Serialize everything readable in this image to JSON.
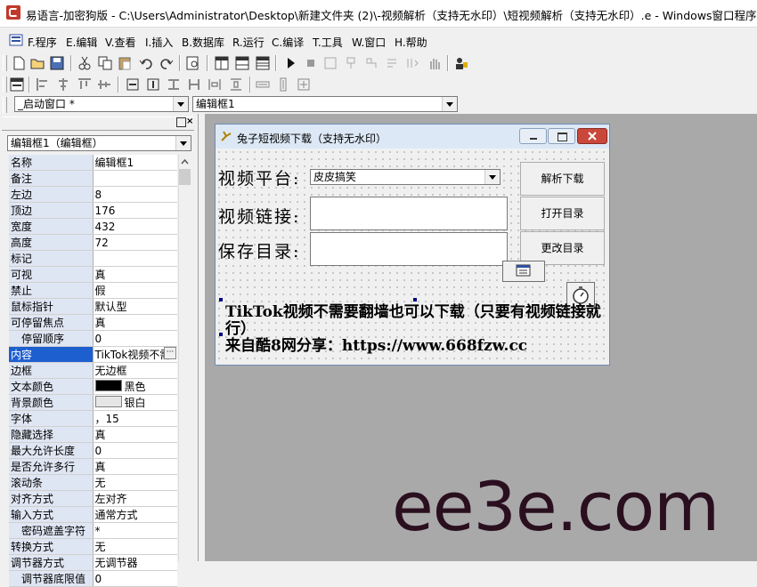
{
  "window": {
    "title": "易语言-加密狗版 - C:\\Users\\Administrator\\Desktop\\新建文件夹 (2)\\-视频解析（支持无水印）\\短视频解析（支持无水印）.e - Windows窗口程序 - [窗口"
  },
  "menu": [
    {
      "label": "F.程序"
    },
    {
      "label": "E.编辑"
    },
    {
      "label": "V.查看"
    },
    {
      "label": "I.插入"
    },
    {
      "label": "B.数据库"
    },
    {
      "label": "R.运行"
    },
    {
      "label": "C.编译"
    },
    {
      "label": "T.工具"
    },
    {
      "label": "W.窗口"
    },
    {
      "label": "H.帮助"
    }
  ],
  "toolbar3": {
    "window_select": "_启动窗口 *",
    "component_select": "编辑框1"
  },
  "prop_panel": {
    "object_select": "编辑框1（编辑框）",
    "rows": [
      {
        "key": "名称",
        "value": "编辑框1"
      },
      {
        "key": "备注",
        "value": ""
      },
      {
        "key": "左边",
        "value": "8"
      },
      {
        "key": "顶边",
        "value": "176"
      },
      {
        "key": "宽度",
        "value": "432"
      },
      {
        "key": "高度",
        "value": "72"
      },
      {
        "key": "标记",
        "value": ""
      },
      {
        "key": "可视",
        "value": "真"
      },
      {
        "key": "禁止",
        "value": "假"
      },
      {
        "key": "鼠标指针",
        "value": "默认型"
      },
      {
        "key": "可停留焦点",
        "value": "真"
      },
      {
        "key": "停留顺序",
        "value": "0"
      },
      {
        "key": "内容",
        "value": "TikTok视频不需"
      },
      {
        "key": "边框",
        "value": "无边框"
      },
      {
        "key": "文本颜色",
        "value": "黑色"
      },
      {
        "key": "背景颜色",
        "value": "银白"
      },
      {
        "key": "字体",
        "value": "，15"
      },
      {
        "key": "隐藏选择",
        "value": "真"
      },
      {
        "key": "最大允许长度",
        "value": "0"
      },
      {
        "key": "是否允许多行",
        "value": "真"
      },
      {
        "key": "滚动条",
        "value": "无"
      },
      {
        "key": "对齐方式",
        "value": "左对齐"
      },
      {
        "key": "输入方式",
        "value": "通常方式"
      },
      {
        "key": "密码遮盖字符",
        "value": "*"
      },
      {
        "key": "转换方式",
        "value": "无"
      },
      {
        "key": "调节器方式",
        "value": "无调节器"
      },
      {
        "key": "调节器底限值",
        "value": "0"
      }
    ],
    "text_color": "#000000",
    "bg_color": "#e6e6e6"
  },
  "form": {
    "title": "兔子短视频下载（支持无水印）",
    "label_platform": "视频平台:",
    "label_link": "视频链接:",
    "label_dir": "保存目录:",
    "platform_value": "皮皮搞笑",
    "btn_parse": "解析下载",
    "btn_open": "打开目录",
    "btn_change": "更改目录",
    "notice_line1": "TikTok视频不需要翻墙也可以下载（只要有视频链接就行）",
    "notice_line2": "来自酷8网分享：https://www.668fzw.cc"
  },
  "watermark": "ee3e.com",
  "colors": {
    "selected_row": "#1e5fd0",
    "key_bg": "#dfe6f3",
    "design_bg": "#a9a9a9"
  }
}
